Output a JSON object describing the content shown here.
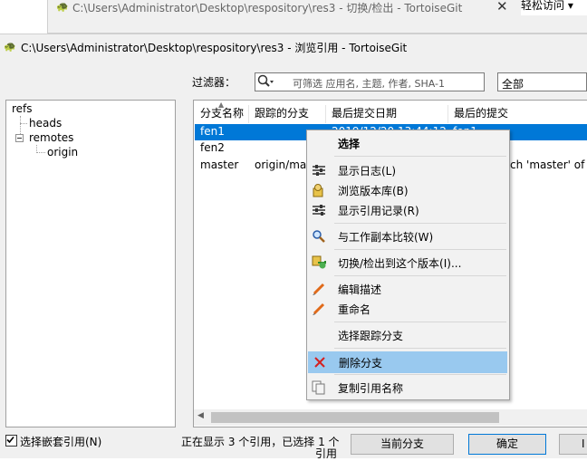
{
  "background_window": {
    "title": "C:\\Users\\Administrator\\Desktop\\respository\\res3 - 切换/检出 - TortoiseGit",
    "close_label": "✕",
    "easy_access": "轻松访问 ▾"
  },
  "window": {
    "title": "C:\\Users\\Administrator\\Desktop\\respository\\res3 - 浏览引用 - TortoiseGit"
  },
  "filter": {
    "label": "过滤器：",
    "placeholder": "可筛选 应用名, 主题, 作者, SHA-1",
    "scope": "全部"
  },
  "tree": {
    "root": "refs",
    "children": [
      {
        "label": "heads"
      },
      {
        "label": "remotes",
        "children": [
          {
            "label": "origin"
          }
        ]
      }
    ]
  },
  "table": {
    "columns": [
      "分支名称",
      "跟踪的分支",
      "最后提交日期",
      "最后的提交"
    ],
    "rows": [
      {
        "name": "fen1",
        "tracked": "",
        "date": "2019/12/20 13:44:12",
        "commit": "fen1"
      },
      {
        "name": "fen2",
        "tracked": "",
        "date": "",
        "commit": ""
      },
      {
        "name": "master",
        "tracked": "origin/mast",
        "date": "",
        "commit": "ch 'master' of g"
      }
    ]
  },
  "context_menu": {
    "items": [
      {
        "label": "选择",
        "icon": "none"
      },
      {
        "label": "显示日志(L)",
        "icon": "log-icon"
      },
      {
        "label": "浏览版本库(B)",
        "icon": "repo-browser-icon"
      },
      {
        "label": "显示引用记录(R)",
        "icon": "reflog-icon"
      },
      {
        "label": "与工作副本比较(W)",
        "icon": "compare-icon"
      },
      {
        "label": "切换/检出到这个版本(I)...",
        "icon": "switch-icon"
      },
      {
        "label": "编辑描述",
        "icon": "edit-icon"
      },
      {
        "label": "重命名",
        "icon": "rename-icon"
      },
      {
        "label": "选择跟踪分支",
        "icon": "none"
      },
      {
        "label": "删除分支",
        "icon": "delete-icon"
      },
      {
        "label": "复制引用名称",
        "icon": "copy-icon"
      }
    ]
  },
  "bottom": {
    "nested_checkbox": "选择嵌套引用(N)",
    "status": "正在显示 3 个引用，已选择 1 个",
    "status_tail": "引用",
    "current_branch_button": "当前分支",
    "ok_button": "确定",
    "extra_button": "I"
  },
  "colors": {
    "selection": "#0078d7",
    "menu_highlight": "#99c9ef",
    "window_bg": "#f0f0f0"
  }
}
